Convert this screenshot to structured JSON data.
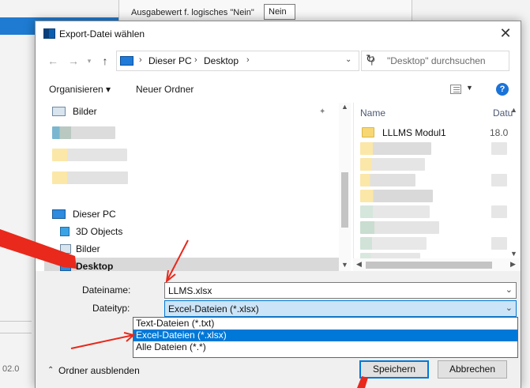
{
  "background": {
    "label": "Ausgabewert f. logisches \"Nein\"",
    "value": "Nein",
    "date": "02.0"
  },
  "dialog": {
    "title": "Export-Datei wählen",
    "close_label": "✕"
  },
  "nav": {
    "back_icon": "←",
    "forward_icon": "→",
    "up_icon": "↑",
    "breadcrumbs": [
      "Dieser PC",
      "Desktop"
    ],
    "refresh_icon": "↻",
    "search_placeholder": "\"Desktop\" durchsuchen"
  },
  "toolbar": {
    "organize_label": "Organisieren ▾",
    "new_folder_label": "Neuer Ordner",
    "help_label": "?"
  },
  "navpane": {
    "items": [
      {
        "label": "Bilder",
        "icon": "pictures-icon"
      },
      {
        "label": "Dieser PC",
        "icon": "computer-icon"
      },
      {
        "label": "3D Objects",
        "icon": "3d-objects-icon"
      },
      {
        "label": "Bilder",
        "icon": "pictures-icon"
      },
      {
        "label": "Desktop",
        "icon": "desktop-icon"
      }
    ]
  },
  "filelist": {
    "col_name": "Name",
    "col_date": "Datu",
    "first_file": {
      "name": "LLLMS Modul1",
      "date": "18.0"
    }
  },
  "form": {
    "filename_label": "Dateiname:",
    "filename_value": "LLMS.xlsx",
    "filetype_label": "Dateityp:",
    "filetype_value": "Excel-Dateien (*.xlsx)",
    "filetype_options": [
      "Text-Dateien (*.txt)",
      "Excel-Dateien (*.xlsx)",
      "Alle Dateien (*.*)"
    ],
    "selected_option_index": 1
  },
  "footer": {
    "hide_folders_label": "Ordner ausblenden",
    "save_label": "Speichern",
    "cancel_label": "Abbrechen"
  },
  "colors": {
    "accent": "#0078d7",
    "annotation": "#e8291c"
  }
}
